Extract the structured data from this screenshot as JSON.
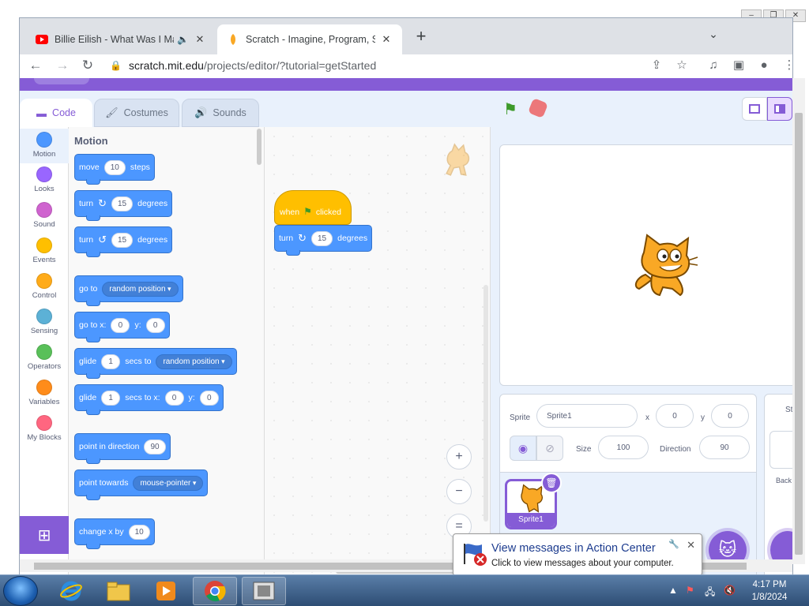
{
  "browser": {
    "tabs": [
      {
        "title": "Billie Eilish - What Was I Made For?",
        "icon": "youtube-icon",
        "audio": true,
        "active": false
      },
      {
        "title": "Scratch - Imagine, Program, Share",
        "icon": "scratch-icon",
        "active": true
      }
    ],
    "new_tab_label": "+",
    "url_host": "scratch.mit.edu",
    "url_path": "/projects/editor/?tutorial=getStarted"
  },
  "editor": {
    "tabs": {
      "code": "Code",
      "costumes": "Costumes",
      "sounds": "Sounds"
    },
    "categories": [
      {
        "label": "Motion",
        "color": "#4C97FF"
      },
      {
        "label": "Looks",
        "color": "#9966FF"
      },
      {
        "label": "Sound",
        "color": "#CF63CF"
      },
      {
        "label": "Events",
        "color": "#FFBF00"
      },
      {
        "label": "Control",
        "color": "#FFAB19"
      },
      {
        "label": "Sensing",
        "color": "#5CB1D6"
      },
      {
        "label": "Operators",
        "color": "#59C059"
      },
      {
        "label": "Variables",
        "color": "#FF8C1A"
      },
      {
        "label": "My Blocks",
        "color": "#FF6680"
      }
    ],
    "palette": {
      "title": "Motion",
      "move": {
        "a": "move",
        "n": "10",
        "b": "steps"
      },
      "turn_right": {
        "a": "turn",
        "n": "15",
        "b": "degrees"
      },
      "turn_left": {
        "a": "turn",
        "n": "15",
        "b": "degrees"
      },
      "goto": {
        "a": "go to",
        "d": "random position"
      },
      "goto_xy": {
        "a": "go to x:",
        "x": "0",
        "yl": "y:",
        "y": "0"
      },
      "glide_to": {
        "a": "glide",
        "n": "1",
        "b": "secs to",
        "d": "random position"
      },
      "glide_xy": {
        "a": "glide",
        "n": "1",
        "b": "secs to x:",
        "x": "0",
        "yl": "y:",
        "y": "0"
      },
      "point_dir": {
        "a": "point in direction",
        "n": "90"
      },
      "point_towards": {
        "a": "point towards",
        "d": "mouse-pointer"
      },
      "change_x": {
        "a": "change x by",
        "n": "10"
      }
    },
    "script": {
      "hat": {
        "a": "when",
        "b": "clicked"
      },
      "turn": {
        "a": "turn",
        "n": "15",
        "b": "degrees"
      }
    },
    "zoom": {
      "in": "+",
      "out": "−",
      "reset": "="
    }
  },
  "sprite_info": {
    "sprite_label": "Sprite",
    "sprite_name": "Sprite1",
    "x_label": "x",
    "x": "0",
    "y_label": "y",
    "y": "0",
    "size_label": "Size",
    "size": "100",
    "direction_label": "Direction",
    "direction": "90",
    "thumb_name": "Sprite1"
  },
  "stage_pane": {
    "label": "Sta",
    "backdrops": "Back"
  },
  "notification": {
    "title": "View messages in Action Center",
    "body": "Click to view messages about your computer."
  },
  "taskbar": {
    "time": "4:17 PM",
    "date": "1/8/2024"
  }
}
